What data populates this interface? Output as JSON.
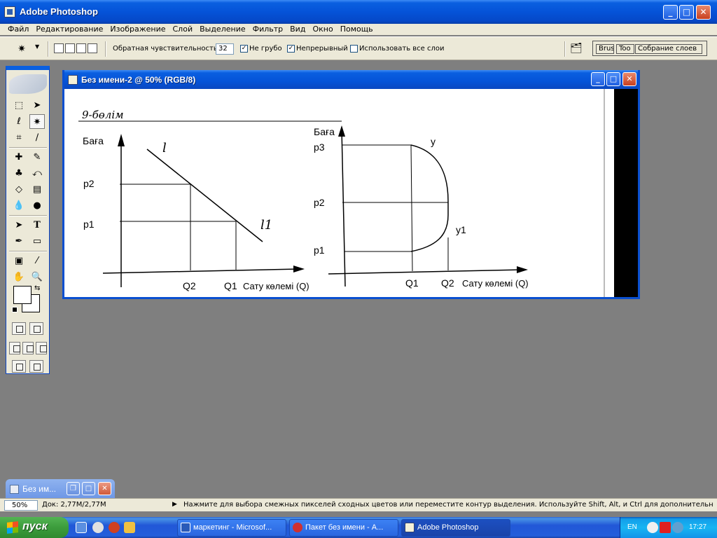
{
  "window": {
    "title": "Adobe Photoshop",
    "buttons": {
      "minimize": "_",
      "maximize": "□",
      "close": "✕"
    }
  },
  "menu": [
    "Файл",
    "Редактирование",
    "Изображение",
    "Слой",
    "Выделение",
    "Фильтр",
    "Вид",
    "Окно",
    "Помощь"
  ],
  "options": {
    "tolerance_label": "Обратная чувствительность:",
    "tolerance_value": "32",
    "antialias_label": "Не грубо",
    "antialias_checked": "✓",
    "contiguous_label": "Непрерывный",
    "contiguous_checked": "✓",
    "all_layers_label": "Использовать все слои",
    "well_tabs": [
      "Brus",
      "Too",
      "Собрание слоев"
    ]
  },
  "document": {
    "title": "Без имени-2 @ 50% (RGB/8)",
    "content": {
      "heading": "9-бөлім",
      "left": {
        "ylabel": "Баға",
        "p2": "p2",
        "p1": "p1",
        "curve_top": "l",
        "curve_bottom": "l1",
        "q2": "Q2",
        "q1": "Q1",
        "xlabel": "Сату көлемі (Q)"
      },
      "right": {
        "ylabel": "Баға",
        "p3": "p3",
        "p2": "p2",
        "p1": "p1",
        "y": "y",
        "y1": "y1",
        "q1": "Q1",
        "q2": "Q2",
        "xlabel": "Сату көлемі (Q)"
      }
    }
  },
  "minimized": {
    "title": "Без им..."
  },
  "status": {
    "zoom": "50%",
    "docsize": "Док: 2,77M/2,77M",
    "hint": "Нажмите для выбора смежных пикселей сходных цветов или переместите контур выделения. Используйте Shift, Alt, и Ctrl для дополнительных опци"
  },
  "taskbar": {
    "start": "пуск",
    "buttons": [
      "маркетинг - Microsof...",
      "Пакет без имени - A...",
      "Adobe Photoshop"
    ],
    "lang": "EN",
    "clock": "17:27"
  }
}
